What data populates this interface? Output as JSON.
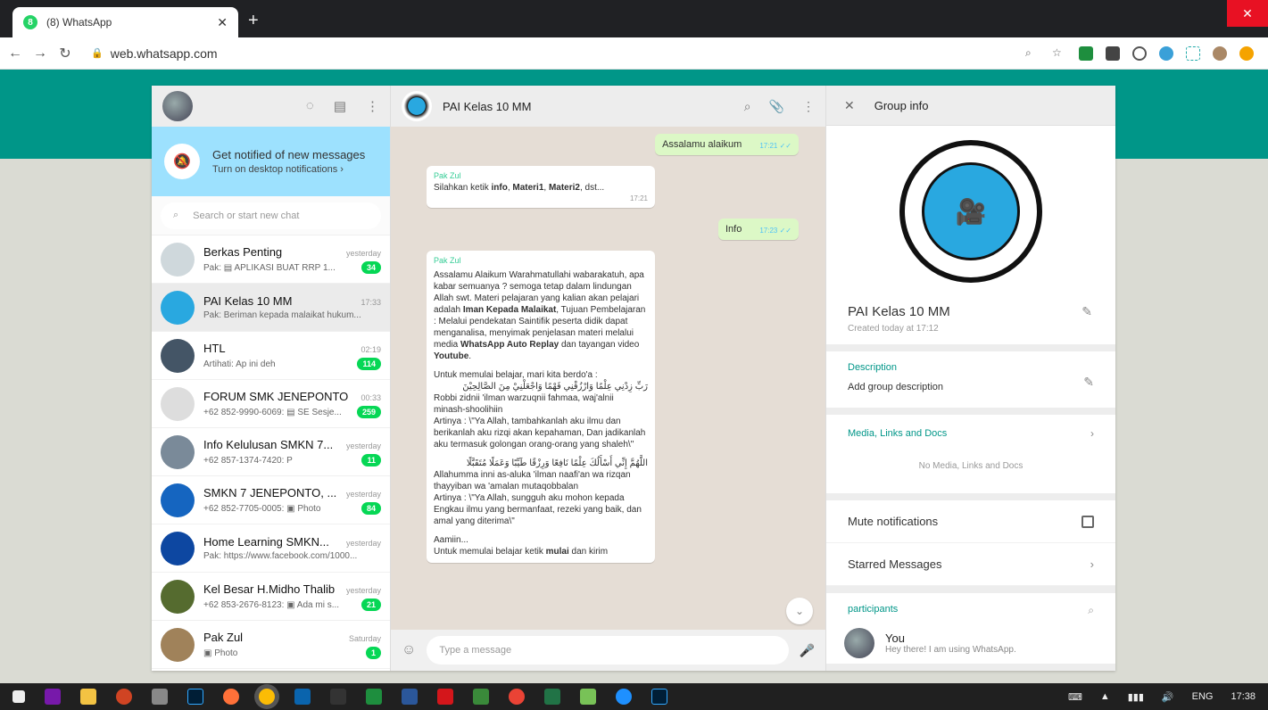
{
  "browser": {
    "tab_title": "(8) WhatsApp",
    "tab_badge": "8",
    "url": "web.whatsapp.com"
  },
  "notification": {
    "title": "Get notified of new messages",
    "subtitle": "Turn on desktop notifications ›"
  },
  "search": {
    "placeholder": "Search or start new chat"
  },
  "chats": [
    {
      "name": "Berkas Penting",
      "time": "yesterday",
      "msg": "Pak: ▤ APLIKASI BUAT RRP 1...",
      "badge": "34"
    },
    {
      "name": "PAI Kelas 10 MM",
      "time": "17:33",
      "msg": "Pak: Beriman kepada malaikat hukum...",
      "badge": ""
    },
    {
      "name": "HTL",
      "time": "02:19",
      "msg": "Artihati: Ap ini deh",
      "badge": "114"
    },
    {
      "name": "FORUM SMK JENEPONTO",
      "time": "00:33",
      "msg": "+62 852-9990-6069: ▤ SE Sesje...",
      "badge": "259"
    },
    {
      "name": "Info Kelulusan SMKN 7...",
      "time": "yesterday",
      "msg": "+62 857-1374-7420: P",
      "badge": "11"
    },
    {
      "name": "SMKN 7 JENEPONTO, ...",
      "time": "yesterday",
      "msg": "+62 852-7705-0005: ▣ Photo",
      "badge": "84"
    },
    {
      "name": "Home Learning SMKN...",
      "time": "yesterday",
      "msg": "Pak: https://www.facebook.com/1000...",
      "badge": ""
    },
    {
      "name": "Kel Besar H.Midho Thalib",
      "time": "yesterday",
      "msg": "+62 853-2676-8123: ▣ Ada mi s...",
      "badge": "21"
    },
    {
      "name": "Pak Zul",
      "time": "Saturday",
      "msg": "▣ Photo",
      "badge": "1"
    }
  ],
  "conversation": {
    "title": "PAI Kelas 10 MM",
    "msg1": {
      "text": "Assalamu alaikum",
      "time": "17:21 ✓✓"
    },
    "msg2": {
      "sender": "Pak Zul",
      "pre": "Silahkan ketik ",
      "b1": "info",
      "m1": ", ",
      "b2": "Materi1",
      "m2": ", ",
      "b3": "Materi2",
      "post": ", dst...",
      "time": "17:21"
    },
    "msg3": {
      "text": "Info",
      "time": "17:23 ✓✓"
    },
    "msg4": {
      "sender": "Pak Zul",
      "p1a": "Assalamu Alaikum Warahmatullahi wabarakatuh, apa kabar semuanya ? semoga tetap dalam lindungan Allah swt. Materi pelajaran yang kalian akan pelajari adalah ",
      "p1b": "Iman Kepada Malaikat",
      "p1c": ", Tujuan Pembelajaran : Melalui pendekatan Saintifik peserta didik dapat menganalisa, menyimak penjelasan materi melalui media ",
      "p1d": "WhatsApp Auto Replay",
      "p1e": " dan tayangan video ",
      "p1f": "Youtube",
      "p1g": ".",
      "p2": "Untuk memulai belajar, mari kita berdo'a :",
      "arab1": "رَبِّ زِدْنِي عِلْمًا وَارْزُقْنِي فَهْمًا وَاجْعَلْنِيْ مِنَ الصَّالِحِيْنَ",
      "p3": "Robbi zidnii 'ilman warzuqnii fahmaa, waj'alnii minash-shoolihiin",
      "p4": "Artinya : \\\"Ya Allah, tambahkanlah aku ilmu dan berikanlah aku rizqi akan kepahaman, Dan jadikanlah aku termasuk golongan orang-orang yang shaleh\\\"",
      "arab2": "اللَّهُمَّ إِنِّي أَسْأَلُكَ عِلْمًا نَافِعًا وَرِزْقًا طَيِّبًا وَعَمَلًا مُتَقَبَّلًا",
      "p5": "Allahumma inni as-aluka 'ilman naafi'an wa rizqan thayyiban wa 'amalan mutaqobbalan",
      "p6": "Artinya : \\\"Ya Allah, sungguh aku mohon kepada Engkau ilmu yang bermanfaat, rezeki yang baik, dan amal yang diterima\\\"",
      "p7": "Aamiin...",
      "p8a": "Untuk memulai belajar ketik ",
      "p8b": "mulai",
      "p8c": " dan kirim"
    },
    "compose_placeholder": "Type a message"
  },
  "group_info": {
    "header": "Group info",
    "name": "PAI Kelas 10 MM",
    "created": "Created today at 17:12",
    "desc_label": "Description",
    "desc_value": "Add group description",
    "media_label": "Media, Links and Docs",
    "media_none": "No Media, Links and Docs",
    "mute": "Mute notifications",
    "starred": "Starred Messages",
    "participants": "participants",
    "you_name": "You",
    "you_status": "Hey there! I am using WhatsApp."
  },
  "taskbar": {
    "lang": "ENG",
    "time": "17:38"
  }
}
